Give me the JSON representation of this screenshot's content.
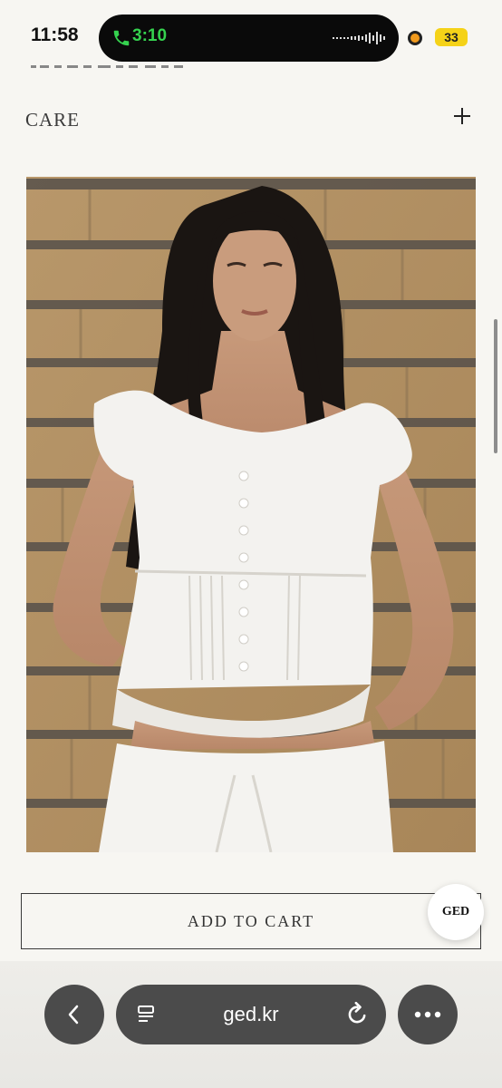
{
  "status_bar": {
    "time": "11:58",
    "call_timer": "3:10",
    "battery_level": "33",
    "icons": [
      "phone-icon",
      "waveform-icon",
      "recording-dot-icon",
      "battery-icon"
    ]
  },
  "product": {
    "care_label": "CARE",
    "care_toggle_icon": "plus-icon",
    "add_to_cart_label": "ADD TO CART",
    "brand_badge": "GED"
  },
  "browser": {
    "url": "ged.kr",
    "icons": [
      "chevron-left-icon",
      "reader-icon",
      "reload-icon",
      "more-icon"
    ]
  },
  "colors": {
    "page_background": "#f7f6f2",
    "toolbar_button": "#4b4b4b",
    "call_green": "#35d24f",
    "battery_yellow": "#f5d218"
  }
}
